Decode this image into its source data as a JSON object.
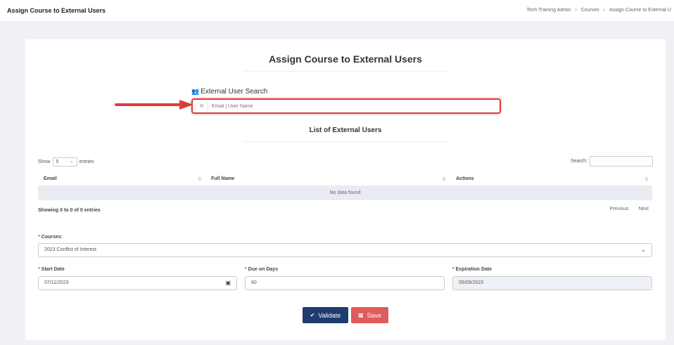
{
  "header": {
    "page_title": "Assign Course to External Users",
    "breadcrumb": [
      "Tech Training Admin",
      "Courses",
      "Assign Course to External U"
    ]
  },
  "card": {
    "title": "Assign Course to External Users",
    "search": {
      "label": "External User Search",
      "placeholder": "Email | User Name"
    },
    "list_title": "List of External Users",
    "table": {
      "show_label": "Show",
      "entries_label": "entries",
      "page_size": "5",
      "search_label": "Search:",
      "columns": [
        "Email",
        "Full Name",
        "Actions"
      ],
      "empty_text": "No data found",
      "info": "Showing 0 to 0 of 0 entries",
      "previous": "Previous",
      "next": "Next"
    },
    "form": {
      "courses_label": "Courses:",
      "courses_value": "2023 Conflict of Interest",
      "start_date_label": "Start Date",
      "start_date_value": "07/11/2023",
      "due_days_label": "Due on Days",
      "due_days_value": "60",
      "expiration_label": "Expiration Date",
      "expiration_value": "09/09/2023"
    },
    "buttons": {
      "validate": "Validate",
      "save": "Save"
    }
  },
  "colors": {
    "highlight": "#e03a3a",
    "validate": "#1f3c6e",
    "save": "#e05b5b"
  }
}
